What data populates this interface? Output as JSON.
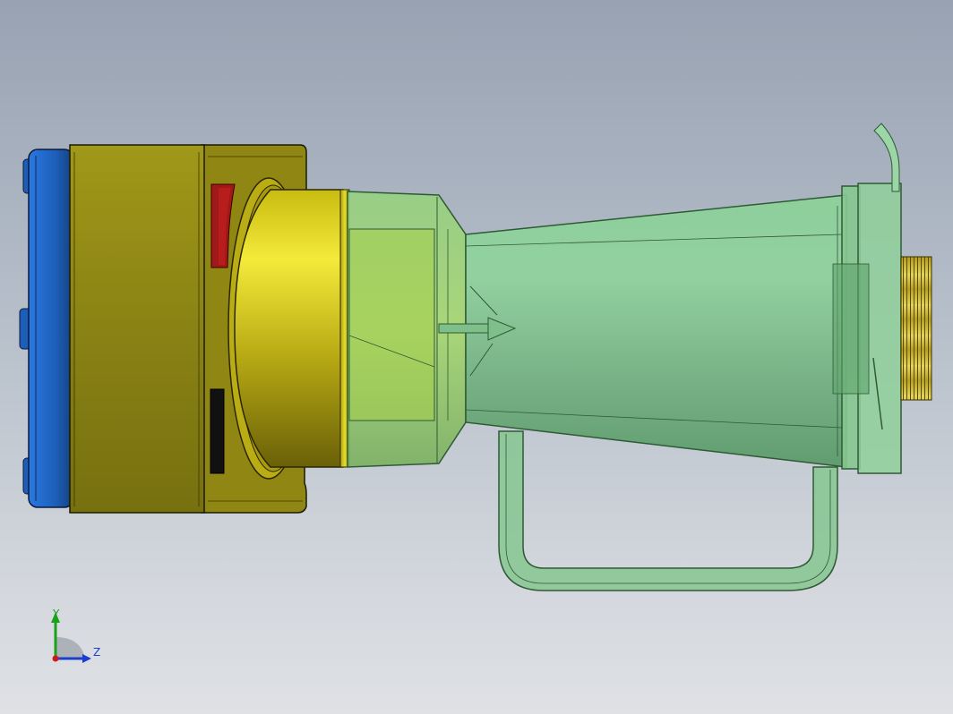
{
  "viewport": {
    "background_top": "#98a2b2",
    "background_bottom": "#dfe1e5"
  },
  "model": {
    "parts": [
      {
        "name": "end-cap",
        "color": "#1f68c8"
      },
      {
        "name": "motor-housing",
        "color": "#8e8615"
      },
      {
        "name": "collar",
        "color": "#e8dc1e"
      },
      {
        "name": "jar",
        "color": "#7cc68c"
      },
      {
        "name": "gear",
        "color": "#c8b432"
      }
    ]
  },
  "triad": {
    "y_label": "Y",
    "z_label": "Z",
    "y_color": "#1aa01a",
    "z_color": "#1a3fd0",
    "x_color": "#d01a1a"
  }
}
